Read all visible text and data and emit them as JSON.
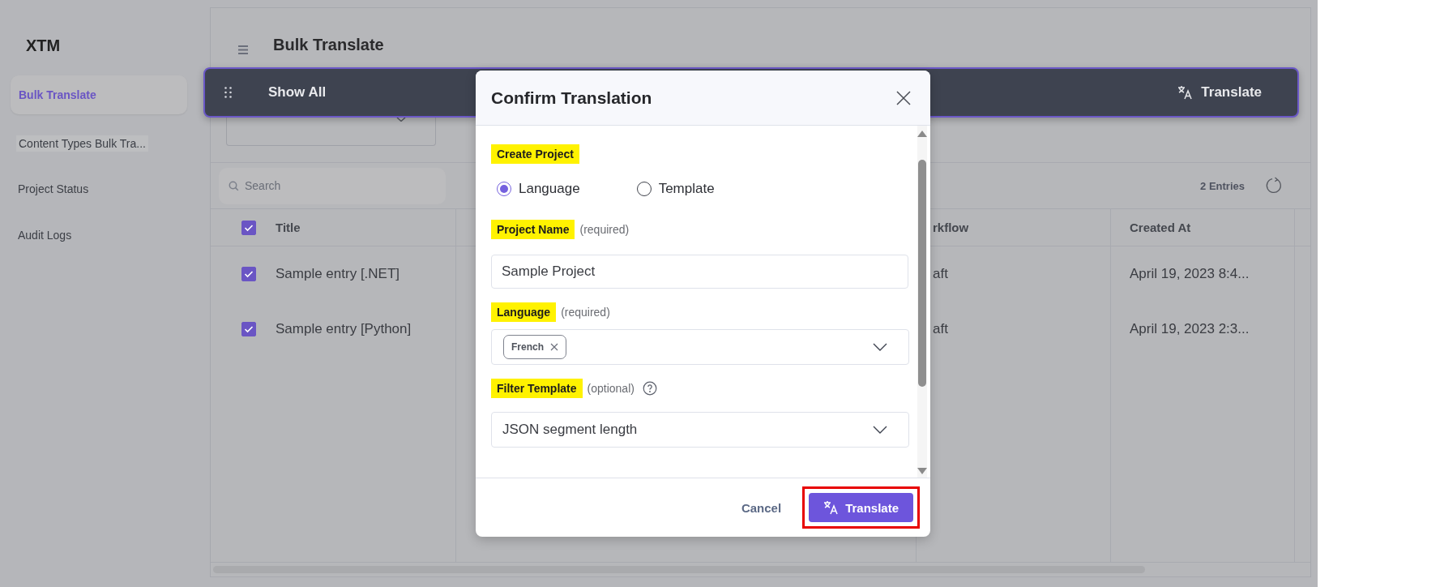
{
  "sidebar": {
    "logo": "XTM",
    "items": [
      {
        "label": "Bulk Translate",
        "selected": true
      },
      {
        "label": "Content Types Bulk Tra...",
        "selected": false
      },
      {
        "label": "Project Status",
        "selected": false
      },
      {
        "label": "Audit Logs",
        "selected": false
      }
    ]
  },
  "header": {
    "title": "Bulk Translate"
  },
  "action_bar": {
    "label": "Show All",
    "button": "Translate"
  },
  "search": {
    "placeholder": "Search"
  },
  "entries": "2 Entries",
  "table": {
    "columns": [
      "Title",
      "rkflow",
      "Created At"
    ],
    "all_checked": true,
    "rows": [
      {
        "checked": true,
        "title": "Sample entry [.NET]",
        "column_3": "aft",
        "created_at": "April 19, 2023 8:4..."
      },
      {
        "checked": true,
        "title": "Sample entry [Python]",
        "column_3": "aft",
        "created_at": "April 19, 2023 2:3..."
      }
    ]
  },
  "dialog": {
    "title": "Confirm Translation",
    "create_project": {
      "label": "Create Project",
      "options": [
        {
          "label": "Language",
          "selected": true
        },
        {
          "label": "Template",
          "selected": false
        }
      ]
    },
    "project_name": {
      "label": "Project Name",
      "hint": "(required)",
      "value": "Sample Project"
    },
    "language": {
      "label": "Language",
      "hint": "(required)",
      "tags": [
        "French"
      ]
    },
    "filter_template": {
      "label": "Filter Template",
      "hint": "(optional)",
      "value": "JSON segment length"
    },
    "cancel": "Cancel",
    "confirm": {
      "label": "Translate",
      "highlighted": true
    }
  }
}
